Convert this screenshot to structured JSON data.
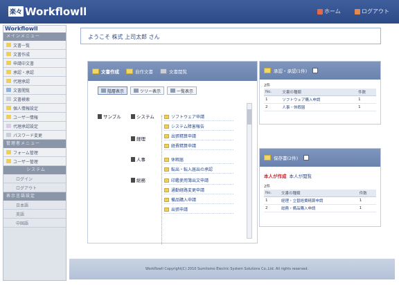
{
  "header": {
    "logo_mark": "楽々",
    "logo_text": "Workflowll",
    "home_link": "ホーム",
    "logout_link": "ログアウト"
  },
  "sidebar": {
    "logo": "Workflowll",
    "head1": "メインメニュー",
    "items1": [
      {
        "label": "文書一覧",
        "color": "#f0cf55"
      },
      {
        "label": "文書作成",
        "color": "#f0cf55"
      },
      {
        "label": "申請中文書",
        "color": "#f0cf55"
      },
      {
        "label": "承認・承認",
        "color": "#f0cf55"
      },
      {
        "label": "代理承認",
        "color": "#f0cf55"
      },
      {
        "label": "文書閲覧",
        "color": "#8ab4e6"
      },
      {
        "label": "文書検索",
        "color": "#c9ced8"
      },
      {
        "label": "個人情報設定",
        "color": "#f0cf55"
      },
      {
        "label": "ユーザー情報",
        "color": "#f0cf55"
      },
      {
        "label": "代理承認設定",
        "color": "#d8cfe6"
      },
      {
        "label": "パスワード変更",
        "color": "#c9ced8"
      }
    ],
    "head2": "管理者メニュー",
    "items2": [
      {
        "label": "フォーム管理",
        "color": "#f0cf55"
      },
      {
        "label": "ユーザー管理",
        "color": "#f0cf55"
      }
    ],
    "head3": "システム",
    "items3": [
      "ログイン",
      "ログアウト"
    ],
    "head4": "表示言語設定",
    "items4": [
      "日本語",
      "英語",
      "中国語"
    ]
  },
  "welcome": "ようこそ 株式 上司太郎 さん",
  "left_panel": {
    "tabs": [
      "文書作成",
      "自作文書",
      "文書閲覧"
    ],
    "views": [
      "階層表示",
      "ツリー表示",
      "一覧表示"
    ],
    "tree_root": "サンプル",
    "categories": [
      "システム",
      "経理",
      "人事",
      "総務"
    ],
    "forms": [
      "ソフトウェア申請",
      "システム障害報告",
      "出張精算申請",
      "経費精算申請",
      "休暇届",
      "転出・転入届出の承認",
      "印鑑使用簿出文申請",
      "通勤経路変更申請",
      "備品購入申請",
      "出張申請"
    ]
  },
  "approval_panel": {
    "title": "承認・承認(1件)",
    "count": "2件",
    "columns": [
      "No.",
      "文書の種類",
      "件数"
    ],
    "rows": [
      {
        "no": "1",
        "type": "ソフトウェア購入申請",
        "count": "1"
      },
      {
        "no": "2",
        "type": "人事・休暇届",
        "count": "1"
      }
    ]
  },
  "draft_panel": {
    "title": "保存書(2件)",
    "note_label": "本人が作成",
    "note_link": "本人が閲覧",
    "count": "2件",
    "columns": [
      "No.",
      "文書の種類",
      "件数"
    ],
    "rows": [
      {
        "no": "1",
        "type": "経理・立替経費精算申請",
        "count": "1"
      },
      {
        "no": "2",
        "type": "総務・備品購入申請",
        "count": "1"
      }
    ]
  },
  "footer": "Workflowll  Copyright(C) 2010 Sumitomo Electric System Solutions Co.,Ltd. All rights reserved."
}
